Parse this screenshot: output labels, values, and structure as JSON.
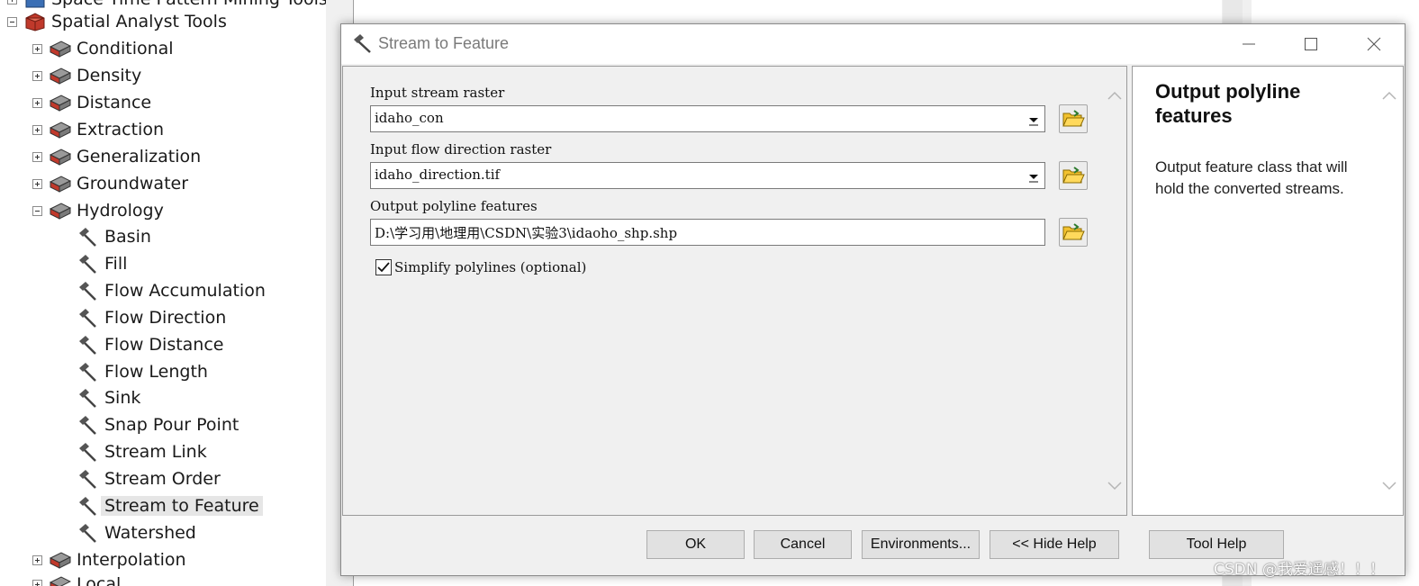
{
  "tree": {
    "partial_top": "Space Time Pattern Mining Tools",
    "root": "Spatial Analyst Tools",
    "toolsets_before": [
      "Conditional",
      "Density",
      "Distance",
      "Extraction",
      "Generalization",
      "Groundwater"
    ],
    "hydrology": "Hydrology",
    "hydrology_tools": [
      "Basin",
      "Fill",
      "Flow Accumulation",
      "Flow Direction",
      "Flow Distance",
      "Flow Length",
      "Sink",
      "Snap Pour Point",
      "Stream Link",
      "Stream Order",
      "Stream to Feature",
      "Watershed"
    ],
    "selected_tool": "Stream to Feature",
    "toolset_after": "Interpolation",
    "partial_bottom": "Local"
  },
  "dialog": {
    "title": "Stream to Feature",
    "params": {
      "stream_raster_label": "Input stream raster",
      "stream_raster_value": "idaho_con",
      "flow_dir_label": "Input flow direction raster",
      "flow_dir_value": "idaho_direction.tif",
      "output_label": "Output polyline features",
      "output_value": "D:\\学习用\\地理用\\CSDN\\实验3\\idaoho_shp.shp",
      "simplify_label": "Simplify polylines (optional)",
      "simplify_checked": true
    },
    "help": {
      "title": "Output polyline features",
      "text": "Output feature class that will hold the converted streams."
    },
    "buttons": {
      "ok": "OK",
      "cancel": "Cancel",
      "environments": "Environments...",
      "hide_help": "<< Hide Help",
      "tool_help": "Tool Help"
    }
  },
  "watermark": "CSDN @我爱遥感！！！",
  "colors": {
    "toolbox_red": "#c0392b",
    "folder_yellow": "#f2c12e",
    "dialog_bg": "#f0f0f0"
  },
  "icons": [
    "toolbox-icon",
    "toolset-icon",
    "hammer-icon",
    "folder-open-icon",
    "dropdown-arrow-icon",
    "checkbox-check-icon"
  ]
}
